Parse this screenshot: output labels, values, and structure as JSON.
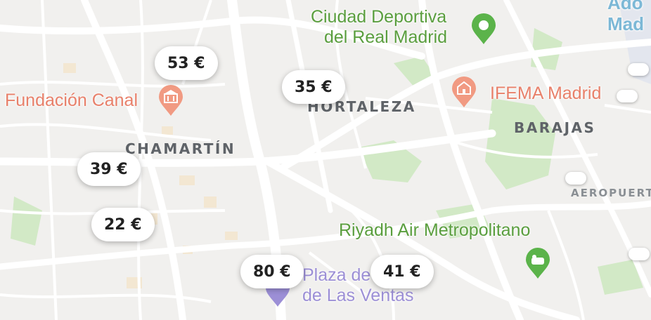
{
  "districts": {
    "chamartin": "CHAMARTÍN",
    "hortaleza": "HORTALEZA",
    "barajas": "BARAJAS",
    "aeropuerto": "AEROPUERT"
  },
  "pois": {
    "ciudad_deportiva_line1": "Ciudad Deportiva",
    "ciudad_deportiva_line2": "del Real Madrid",
    "fundacion_canal": "Fundación Canal",
    "ifema": "IFEMA Madrid",
    "metropolitano": "Riyadh Air Metropolitano",
    "plaza_line1": "Plaza de Toros",
    "plaza_line2": "de Las Ventas",
    "corner_line1": "Ado",
    "corner_line2": "Mad"
  },
  "price_markers": {
    "p53": "53 €",
    "p35": "35 €",
    "p39": "39 €",
    "p22": "22 €",
    "p80": "80 €",
    "p41": "41 €"
  },
  "colors": {
    "land": "#f1f0ee",
    "road": "#ffffff",
    "park": "#cfe8c4",
    "building": "#f3e6cf",
    "green_poi": "#5a9e3e",
    "orange_poi": "#e8806a",
    "purple_poi": "#9c8fd6"
  }
}
